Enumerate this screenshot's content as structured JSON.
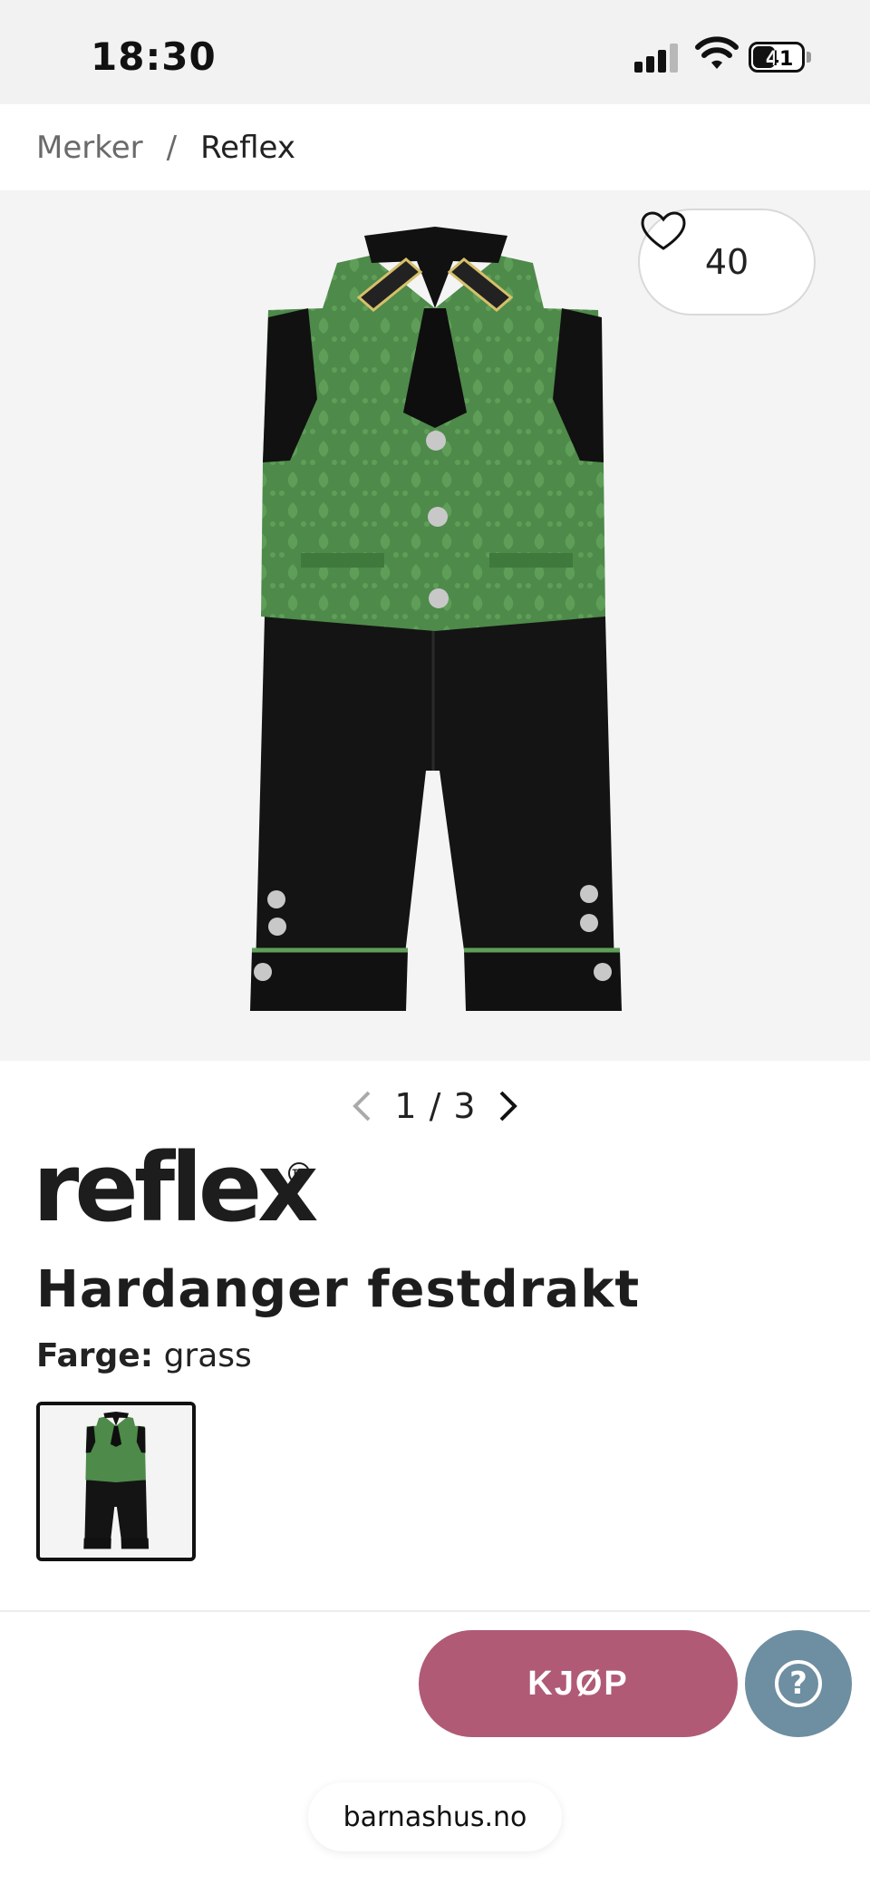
{
  "status_bar": {
    "time": "18:30",
    "battery": "41"
  },
  "breadcrumb": {
    "parent": "Merker",
    "separator": "/",
    "current": "Reflex"
  },
  "product": {
    "like_count": "40",
    "brand": "reflex",
    "brand_mark": "TM",
    "title": "Hardanger festdrakt",
    "color_label": "Farge:",
    "color_value": "grass",
    "buy_label": "KJØP"
  },
  "pagination": {
    "current": "1",
    "separator": "/",
    "total": "3"
  },
  "browser": {
    "url": "barnashus.no"
  },
  "colors": {
    "vest_green": "#4e8a4a",
    "black": "#111111",
    "buy_button": "#b05a76",
    "help_button": "#6e8ea1",
    "hero_bg": "#f4f4f4"
  },
  "icons": [
    "heart-icon",
    "chevron-left-icon",
    "chevron-right-icon",
    "help-icon",
    "wifi-icon",
    "signal-icon",
    "battery-icon"
  ]
}
